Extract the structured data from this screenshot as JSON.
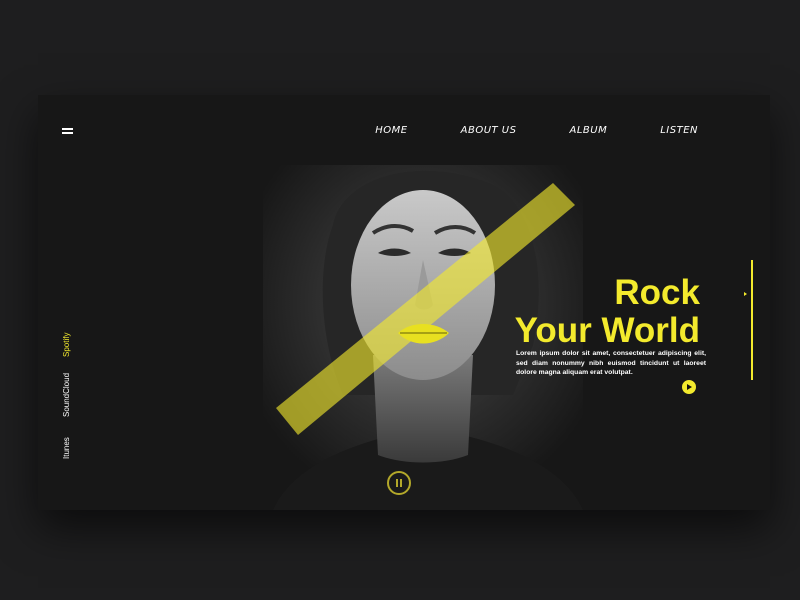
{
  "nav": {
    "items": [
      {
        "label": "HOME"
      },
      {
        "label": "ABOUT US"
      },
      {
        "label": "ALBUM"
      },
      {
        "label": "LISTEN"
      }
    ]
  },
  "hero": {
    "title_line1": "Rock",
    "title_line2": "Your World",
    "description": "Lorem ipsum dolor sit amet, consectetuer adipiscing elit, sed diam nonummy nibh euismod tincidunt ut laoreet dolore magna aliquam erat volutpat."
  },
  "sidebar": {
    "links": [
      {
        "label": "Spotify"
      },
      {
        "label": "SoundCloud"
      },
      {
        "label": "Itunes"
      }
    ]
  },
  "colors": {
    "accent": "#f3ea2d",
    "background": "#1e1e1f",
    "card": "#171717",
    "text": "#ffffff"
  },
  "icons": {
    "menu": "hamburger-menu-icon",
    "play": "play-icon",
    "pause": "pause-icon"
  },
  "player": {
    "state": "playing"
  }
}
